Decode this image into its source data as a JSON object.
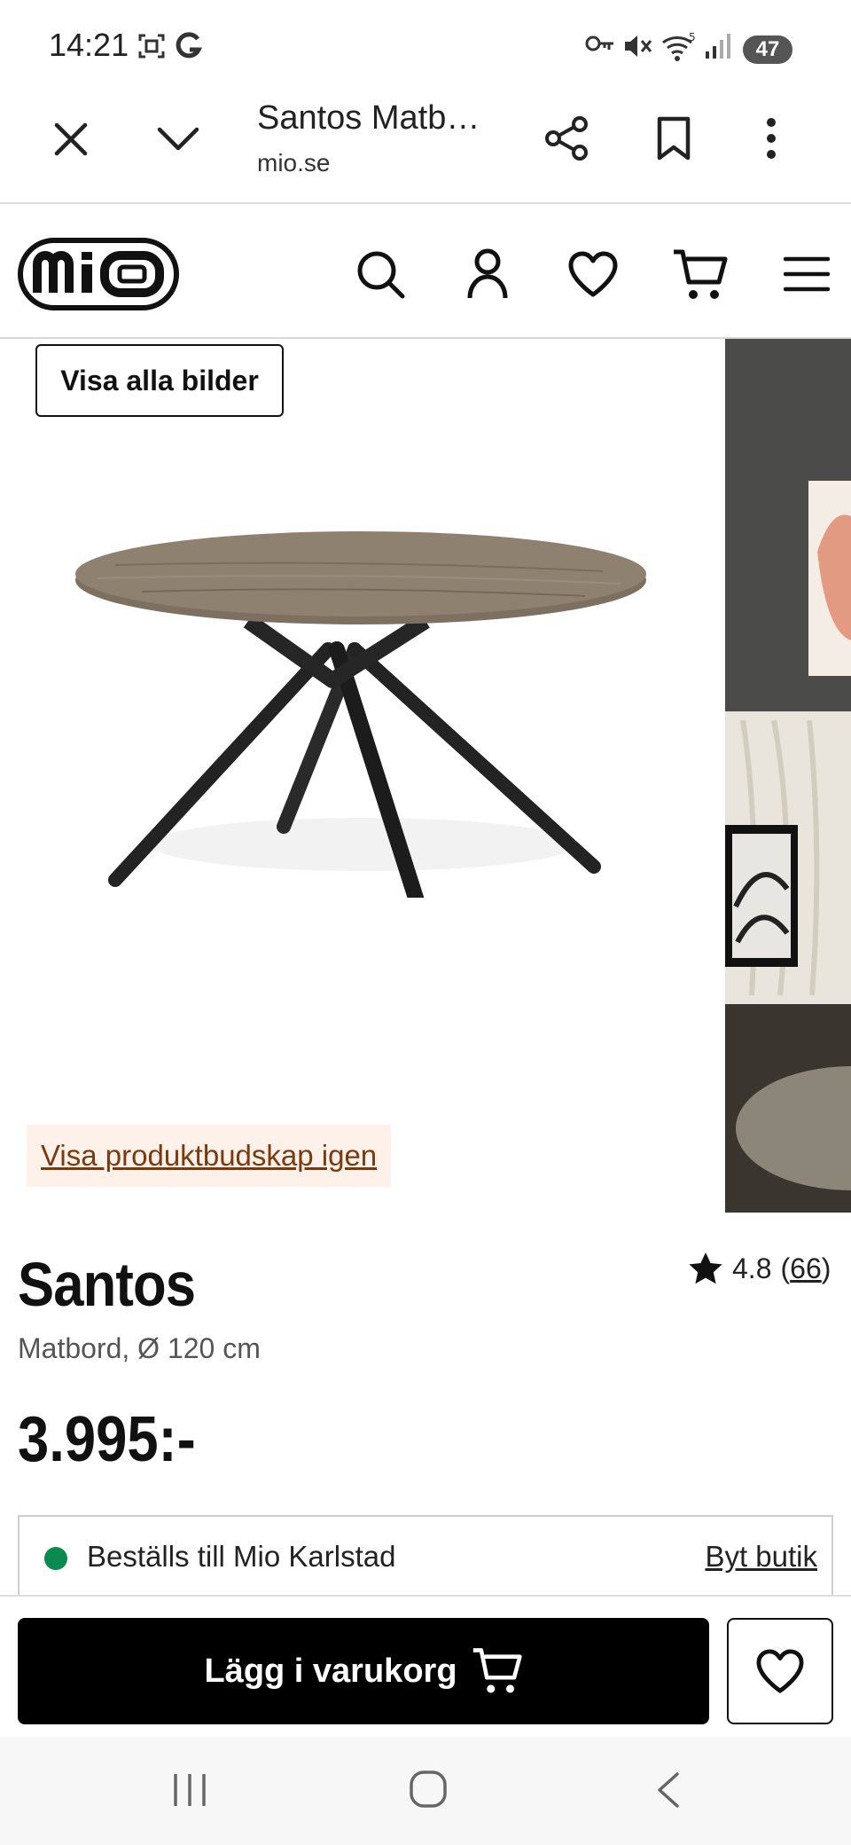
{
  "status_bar": {
    "time": "14:21",
    "battery": "47",
    "icons": [
      "screenshot-icon",
      "g-icon",
      "vpn-key-icon",
      "mute-icon",
      "wifi-icon",
      "signal-icon",
      "battery-icon"
    ]
  },
  "browser": {
    "page_title": "Santos Matb…",
    "domain": "mio.se",
    "icons": [
      "close-icon",
      "chevron-down-icon",
      "share-icon",
      "bookmark-icon",
      "more-vert-icon"
    ]
  },
  "site_header": {
    "logo": "mio",
    "icons": [
      "search-icon",
      "account-icon",
      "heart-icon",
      "cart-icon",
      "menu-icon"
    ]
  },
  "gallery": {
    "view_all_label": "Visa alla bilder",
    "show_message_label": "Visa produktbudskap igen"
  },
  "product": {
    "name": "Santos",
    "rating": "4.8",
    "review_count": "66",
    "rating_open": "(",
    "rating_close": ")",
    "description": "Matbord, Ø 120 cm",
    "price": "3.995:-"
  },
  "store": {
    "status_text": "Beställs till Mio Karlstad",
    "change_label": "Byt butik",
    "status_color": "#0a8a50"
  },
  "buy_bar": {
    "add_to_cart_label": "Lägg i varukorg"
  },
  "nav_bar": {
    "icons": [
      "recent-apps-icon",
      "home-icon",
      "back-icon"
    ]
  }
}
